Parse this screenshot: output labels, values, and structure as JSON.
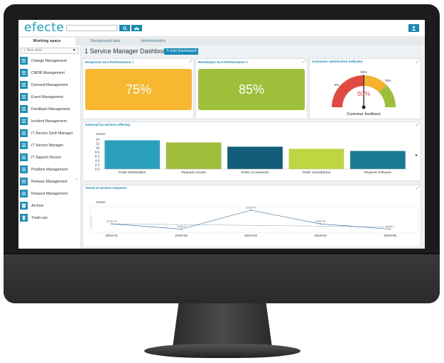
{
  "app": {
    "logo": "efecte",
    "search_placeholder": ""
  },
  "tabs": [
    {
      "label": "Working space",
      "active": true
    },
    {
      "label": "Background data",
      "active": false
    },
    {
      "label": "Administration",
      "active": false
    }
  ],
  "sidebar": {
    "new_view": "New view",
    "items": [
      {
        "label": "Change Management",
        "icon": "table-icon"
      },
      {
        "label": "CMDB Management",
        "icon": "table-icon"
      },
      {
        "label": "Demand Management",
        "icon": "table-icon"
      },
      {
        "label": "Event Management",
        "icon": "table-icon"
      },
      {
        "label": "Feedback Management",
        "icon": "table-icon"
      },
      {
        "label": "Incident Management",
        "icon": "table-icon"
      },
      {
        "label": "IT Service Desk Manager",
        "icon": "table-icon"
      },
      {
        "label": "IT Service Manager",
        "icon": "table-icon"
      },
      {
        "label": "IT Support Person",
        "icon": "table-icon"
      },
      {
        "label": "Problem Management",
        "icon": "table-icon"
      },
      {
        "label": "Release Management",
        "icon": "table-icon"
      },
      {
        "label": "Request Management",
        "icon": "table-icon"
      },
      {
        "label": "Archive",
        "icon": "archive-icon"
      },
      {
        "label": "Trash can",
        "icon": "trash-icon"
      }
    ]
  },
  "dashboard": {
    "title": "1 Service Manager Dashboard",
    "edit_label": "Edit Dashboard",
    "panels": {
      "response_sla": {
        "title": "Response SLA Performance",
        "info": "i",
        "value": "75%",
        "color": "#f7b731"
      },
      "resolution_sla": {
        "title": "Resolution SLA Performance",
        "info": "i",
        "value": "85%",
        "color": "#9dbf3a"
      },
      "satisfaction": {
        "title": "Customer satisfaction indicator",
        "label": "Customer feedback",
        "value": "50%",
        "tick_left": "0%",
        "tick_top": "50%",
        "tick_right": "75%"
      },
      "demand": {
        "title": "Demand by service offering"
      },
      "trend": {
        "title": "Trend of service requests"
      }
    }
  },
  "chart_data": [
    {
      "type": "bar",
      "title": "",
      "ylabel": "Count",
      "yticks": [
        "14",
        "12",
        "10",
        "8.0",
        "6.0",
        "4.0",
        "2.0",
        "0.0"
      ],
      "ylim": [
        0,
        14
      ],
      "categories": [
        "Order Workstation",
        "Request Access",
        "Order Accessories",
        "Order Smartphone",
        "Request Software"
      ],
      "values": [
        13.5,
        12.5,
        10.5,
        9.5,
        8.5
      ],
      "colors": [
        "#2a9fbe",
        "#9dbd3b",
        "#145d7a",
        "#bfd642",
        "#187b93"
      ]
    },
    {
      "type": "line",
      "title": "",
      "ylabel": "Count",
      "categories": [
        "2018-01",
        "2018-02",
        "2018-03",
        "2018-04",
        "2018-06"
      ],
      "series": [
        {
          "values": [
            16,
            4,
            47,
            16,
            4
          ],
          "point_labels": [
            "Count: 16",
            "Count: 4",
            "Count: 47",
            "Count: 16",
            "Count: 4"
          ]
        }
      ],
      "trend_start": 16,
      "trend_end": 9,
      "ylim": [
        0,
        55
      ]
    }
  ]
}
